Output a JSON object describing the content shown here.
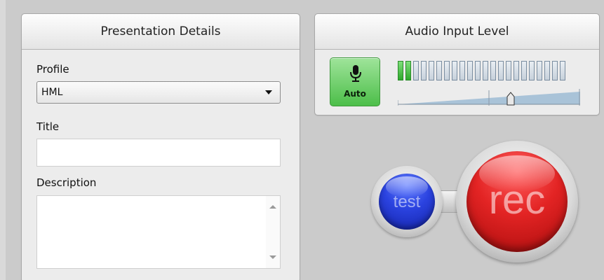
{
  "details_panel": {
    "header": "Presentation Details",
    "profile": {
      "label": "Profile",
      "value": "HML"
    },
    "title": {
      "label": "Title",
      "value": ""
    },
    "description": {
      "label": "Description",
      "value": ""
    }
  },
  "audio_panel": {
    "header": "Audio Input Level",
    "auto_button": {
      "label": "Auto",
      "icon": "microphone-icon",
      "color": "#4cbe49"
    },
    "meter": {
      "segments_total": 22,
      "segments_active": 2,
      "active_color": "#2ea82b"
    },
    "input_level_slider": {
      "value_fraction": 0.62
    }
  },
  "controls": {
    "test_label": "test",
    "rec_label": "rec",
    "test_color": "#2b43e0",
    "rec_color": "#e32424"
  }
}
